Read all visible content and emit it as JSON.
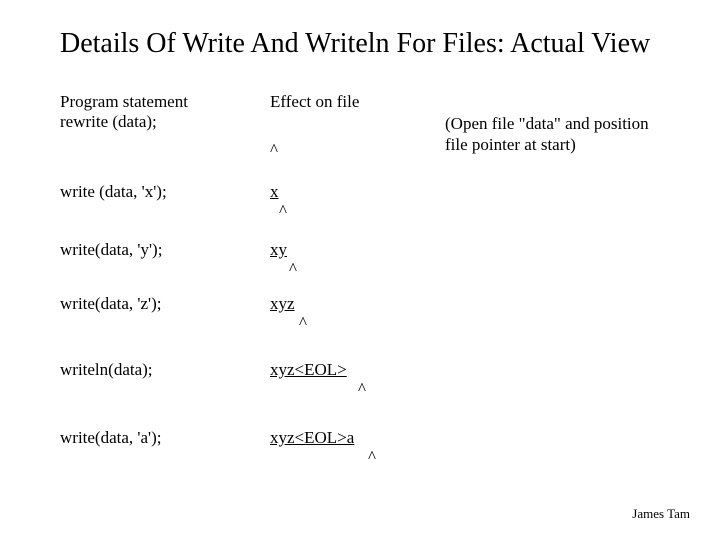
{
  "title": "Details Of Write And Writeln For Files: Actual View",
  "headers": {
    "left_line1": "Program statement",
    "left_line2": "rewrite (data);",
    "mid": "Effect on file"
  },
  "note_line1": "(Open file \"data\" and position",
  "note_line2": "  file pointer at start)",
  "rows": {
    "r1_caret": "^",
    "r2_stmt": "write (data, 'x');",
    "r2_out": "x",
    "r2_caret": "^",
    "r3_stmt": "write(data, 'y');",
    "r3_out": "xy",
    "r3_caret": "^",
    "r4_stmt": "write(data, 'z');",
    "r4_out": "xyz",
    "r4_caret": "^",
    "r5_stmt": "writeln(data);",
    "r5_out": "xyz<EOL>",
    "r5_caret": "^",
    "r6_stmt": "write(data, 'a');",
    "r6_out": "xyz<EOL>a",
    "r6_caret": "^"
  },
  "footer": "James Tam"
}
